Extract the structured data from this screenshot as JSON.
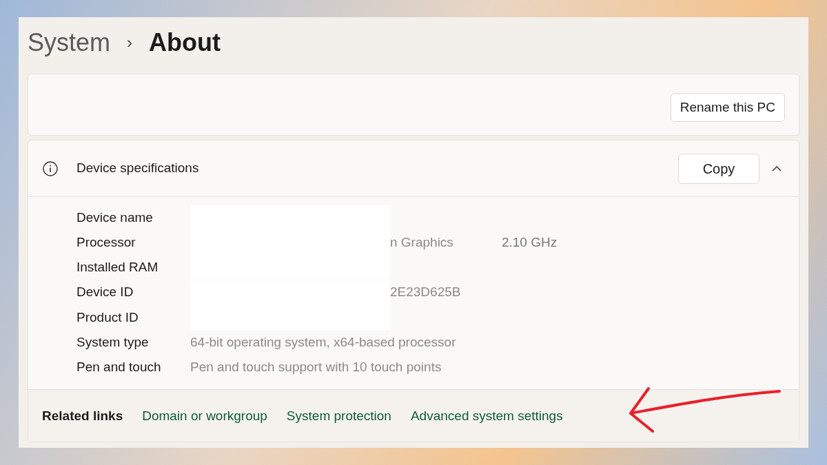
{
  "breadcrumb": {
    "parent": "System",
    "separator": "›",
    "current": "About"
  },
  "rename_button": "Rename this PC",
  "specs": {
    "title": "Device specifications",
    "copy_button": "Copy",
    "expanded": true,
    "rows": [
      {
        "label": "Device name",
        "redacted": true,
        "value": "",
        "extra": ""
      },
      {
        "label": "Processor",
        "redacted": true,
        "value": "n Graphics",
        "extra": "2.10 GHz"
      },
      {
        "label": "Installed RAM",
        "redacted": true,
        "value": "",
        "extra": ""
      },
      {
        "label": "Device ID",
        "redacted": true,
        "value": "2E23D625B",
        "extra": ""
      },
      {
        "label": "Product ID",
        "redacted": true,
        "value": "",
        "extra": ""
      },
      {
        "label": "System type",
        "redacted": false,
        "value": "64-bit operating system, x64-based processor",
        "extra": ""
      },
      {
        "label": "Pen and touch",
        "redacted": false,
        "value": "Pen and touch support with 10 touch points",
        "extra": ""
      }
    ]
  },
  "related_links": {
    "label": "Related links",
    "links": [
      "Domain or workgroup",
      "System protection",
      "Advanced system settings"
    ]
  }
}
